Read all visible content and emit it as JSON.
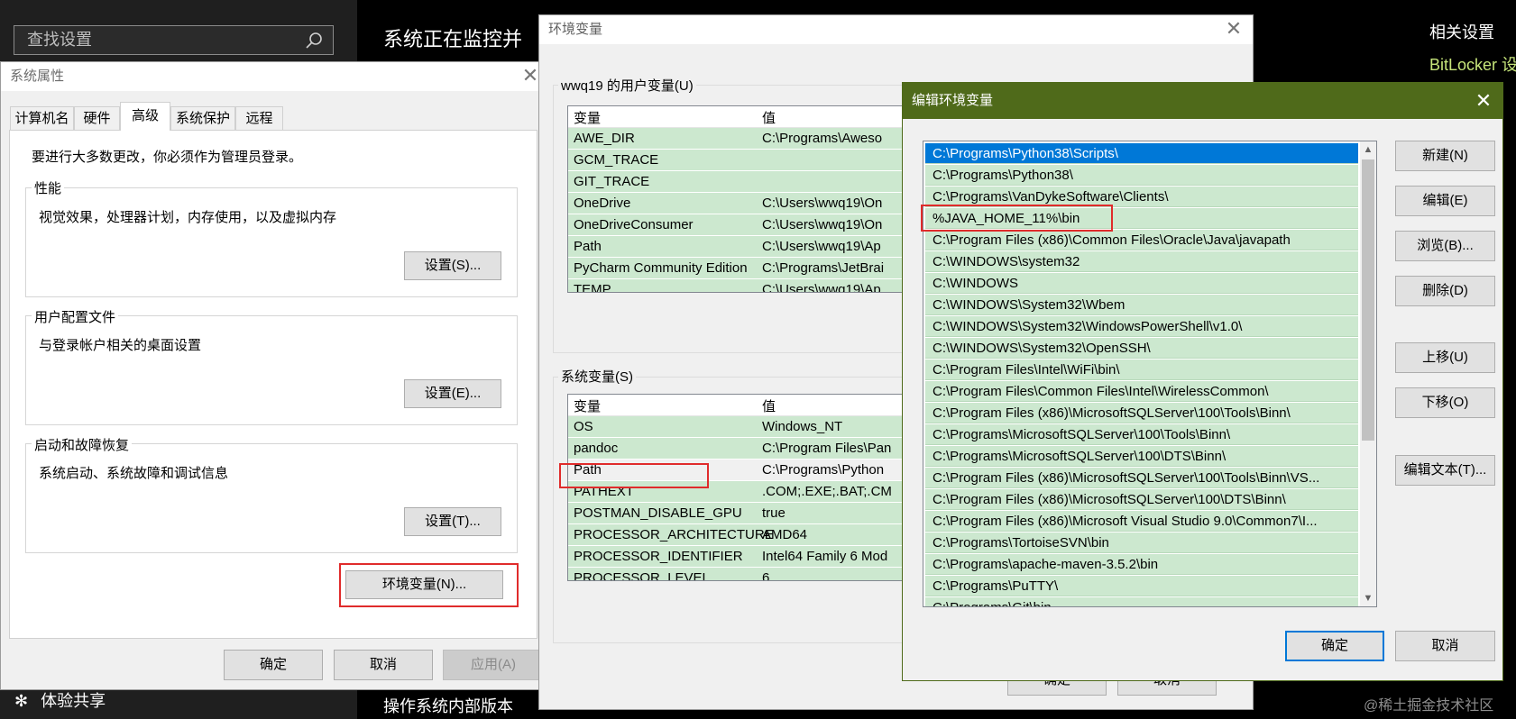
{
  "settings": {
    "search_placeholder": "查找设置",
    "monitor_text": "系统正在监控并",
    "related_title": "相关设置",
    "bitlocker": "BitLocker 设",
    "share": "体验共享",
    "os_version": "操作系统内部版本",
    "watermark": "@稀土掘金技术社区"
  },
  "sysprops": {
    "title": "系统属性",
    "tabs": [
      "计算机名",
      "硬件",
      "高级",
      "系统保护",
      "远程"
    ],
    "admin_note": "要进行大多数更改，你必须作为管理员登录。",
    "performance": {
      "title": "性能",
      "desc": "视觉效果，处理器计划，内存使用，以及虚拟内存",
      "button": "设置(S)..."
    },
    "profile": {
      "title": "用户配置文件",
      "desc": "与登录帐户相关的桌面设置",
      "button": "设置(E)..."
    },
    "startup": {
      "title": "启动和故障恢复",
      "desc": "系统启动、系统故障和调试信息",
      "button": "设置(T)..."
    },
    "env_button": "环境变量(N)...",
    "ok": "确定",
    "cancel": "取消",
    "apply": "应用(A)"
  },
  "envvars": {
    "title": "环境变量",
    "user_section": "wwq19 的用户变量(U)",
    "system_section": "系统变量(S)",
    "col_var": "变量",
    "col_val": "值",
    "user_vars": [
      {
        "name": "AWE_DIR",
        "value": "C:\\Programs\\Aweso"
      },
      {
        "name": "GCM_TRACE",
        "value": ""
      },
      {
        "name": "GIT_TRACE",
        "value": ""
      },
      {
        "name": "OneDrive",
        "value": "C:\\Users\\wwq19\\On"
      },
      {
        "name": "OneDriveConsumer",
        "value": "C:\\Users\\wwq19\\On"
      },
      {
        "name": "Path",
        "value": "C:\\Users\\wwq19\\Ap"
      },
      {
        "name": "PyCharm Community Edition",
        "value": "C:\\Programs\\JetBrai"
      },
      {
        "name": "TEMP",
        "value": "C:\\Users\\wwq19\\Ap"
      }
    ],
    "system_vars": [
      {
        "name": "OS",
        "value": "Windows_NT"
      },
      {
        "name": "pandoc",
        "value": "C:\\Program Files\\Pan"
      },
      {
        "name": "Path",
        "value": "C:\\Programs\\Python"
      },
      {
        "name": "PATHEXT",
        "value": ".COM;.EXE;.BAT;.CM"
      },
      {
        "name": "POSTMAN_DISABLE_GPU",
        "value": "true"
      },
      {
        "name": "PROCESSOR_ARCHITECTURE",
        "value": "AMD64"
      },
      {
        "name": "PROCESSOR_IDENTIFIER",
        "value": "Intel64 Family 6 Mod"
      },
      {
        "name": "PROCESSOR_LEVEL",
        "value": "6"
      }
    ],
    "ok": "确定",
    "cancel": "取消"
  },
  "editenv": {
    "title": "编辑环境变量",
    "paths": [
      "C:\\Programs\\Python38\\Scripts\\",
      "C:\\Programs\\Python38\\",
      "C:\\Programs\\VanDykeSoftware\\Clients\\",
      "%JAVA_HOME_11%\\bin",
      "C:\\Program Files (x86)\\Common Files\\Oracle\\Java\\javapath",
      "C:\\WINDOWS\\system32",
      "C:\\WINDOWS",
      "C:\\WINDOWS\\System32\\Wbem",
      "C:\\WINDOWS\\System32\\WindowsPowerShell\\v1.0\\",
      "C:\\WINDOWS\\System32\\OpenSSH\\",
      "C:\\Program Files\\Intel\\WiFi\\bin\\",
      "C:\\Program Files\\Common Files\\Intel\\WirelessCommon\\",
      "C:\\Program Files (x86)\\MicrosoftSQLServer\\100\\Tools\\Binn\\",
      "C:\\Programs\\MicrosoftSQLServer\\100\\Tools\\Binn\\",
      "C:\\Programs\\MicrosoftSQLServer\\100\\DTS\\Binn\\",
      "C:\\Program Files (x86)\\MicrosoftSQLServer\\100\\Tools\\Binn\\VS...",
      "C:\\Program Files (x86)\\MicrosoftSQLServer\\100\\DTS\\Binn\\",
      "C:\\Program Files (x86)\\Microsoft Visual Studio 9.0\\Common7\\I...",
      "C:\\Programs\\TortoiseSVN\\bin",
      "C:\\Programs\\apache-maven-3.5.2\\bin",
      "C:\\Programs\\PuTTY\\",
      "C:\\Programs\\Git\\bin"
    ],
    "buttons": {
      "new": "新建(N)",
      "edit": "编辑(E)",
      "browse": "浏览(B)...",
      "delete": "删除(D)",
      "up": "上移(U)",
      "down": "下移(O)",
      "edit_text": "编辑文本(T)..."
    },
    "ok": "确定",
    "cancel": "取消"
  },
  "colors": {
    "title_bar_green": "#4f6a1a",
    "list_green": "#cce8cf",
    "selection_blue": "#0078d7",
    "highlight_red": "#e02b2b"
  }
}
